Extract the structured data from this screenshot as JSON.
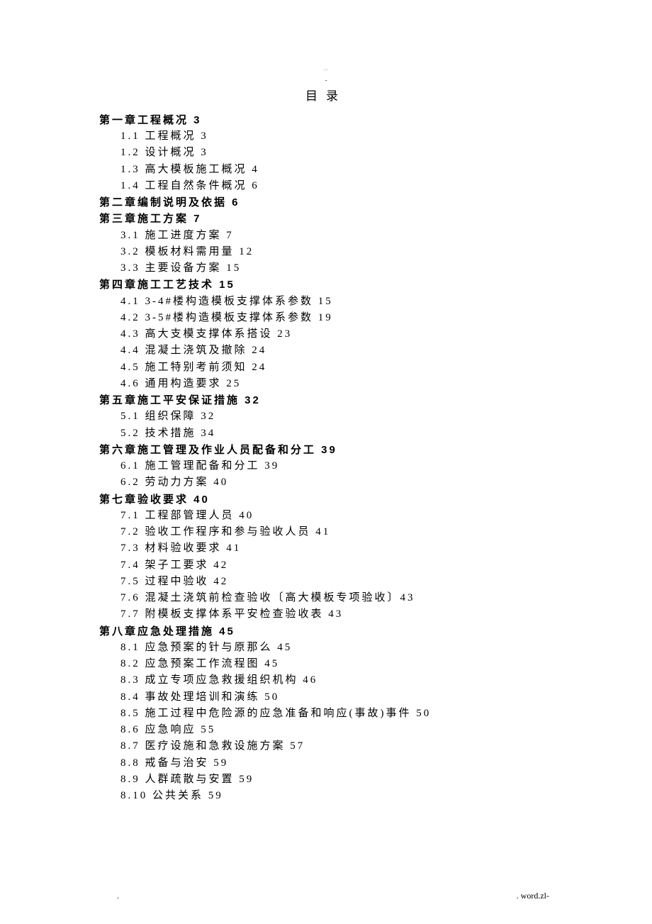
{
  "header_dots": "..",
  "header_dash": "-",
  "title": "目录",
  "footer_left": ".",
  "footer_right": ". word.zl-",
  "toc": [
    {
      "type": "chapter",
      "text": "第一章工程概况 3"
    },
    {
      "type": "section",
      "text": "1.1 工程概况 3"
    },
    {
      "type": "section",
      "text": "1.2 设计概况 3"
    },
    {
      "type": "section",
      "text": "1.3 高大模板施工概况 4"
    },
    {
      "type": "section",
      "text": "1.4 工程自然条件概况 6"
    },
    {
      "type": "chapter",
      "text": "第二章编制说明及依据 6"
    },
    {
      "type": "chapter",
      "text": "第三章施工方案 7"
    },
    {
      "type": "section",
      "text": "3.1 施工进度方案 7"
    },
    {
      "type": "section",
      "text": "3.2 模板材料需用量 12"
    },
    {
      "type": "section",
      "text": "3.3 主要设备方案 15"
    },
    {
      "type": "chapter",
      "text": "第四章施工工艺技术 15"
    },
    {
      "type": "section",
      "text": "4.1 3-4#楼构造模板支撑体系参数 15"
    },
    {
      "type": "section",
      "text": "4.2 3-5#楼构造模板支撑体系参数 19"
    },
    {
      "type": "section",
      "text": "4.3 高大支模支撑体系搭设 23"
    },
    {
      "type": "section",
      "text": "4.4 混凝土浇筑及撤除 24"
    },
    {
      "type": "section",
      "text": "4.5 施工特别考前须知 24"
    },
    {
      "type": "section",
      "text": "4.6 通用构造要求 25"
    },
    {
      "type": "chapter",
      "text": "第五章施工平安保证措施 32"
    },
    {
      "type": "section",
      "text": "5.1 组织保障 32"
    },
    {
      "type": "section",
      "text": "5.2 技术措施 34"
    },
    {
      "type": "chapter",
      "text": "第六章施工管理及作业人员配备和分工 39"
    },
    {
      "type": "section",
      "text": "6.1 施工管理配备和分工 39"
    },
    {
      "type": "section",
      "text": "6.2 劳动力方案 40"
    },
    {
      "type": "chapter",
      "text": "第七章验收要求 40"
    },
    {
      "type": "section",
      "text": "7.1 工程部管理人员 40"
    },
    {
      "type": "section",
      "text": "7.2 验收工作程序和参与验收人员 41"
    },
    {
      "type": "section",
      "text": "7.3 材料验收要求 41"
    },
    {
      "type": "section",
      "text": "7.4 架子工要求 42"
    },
    {
      "type": "section",
      "text": "7.5 过程中验收 42"
    },
    {
      "type": "section",
      "text": "7.6 混凝土浇筑前检查验收〔高大模板专项验收〕43"
    },
    {
      "type": "section",
      "text": "7.7 附模板支撑体系平安检查验收表 43"
    },
    {
      "type": "chapter",
      "text": "第八章应急处理措施 45"
    },
    {
      "type": "section",
      "text": "8.1 应急预案的针与原那么 45"
    },
    {
      "type": "section",
      "text": "8.2 应急预案工作流程图 45"
    },
    {
      "type": "section",
      "text": "8.3 成立专项应急救援组织机构 46"
    },
    {
      "type": "section",
      "text": "8.4 事故处理培训和演练 50"
    },
    {
      "type": "section",
      "text": "8.5 施工过程中危险源的应急准备和响应(事故)事件 50"
    },
    {
      "type": "section",
      "text": "8.6 应急响应 55"
    },
    {
      "type": "section",
      "text": "8.7 医疗设施和急救设施方案 57"
    },
    {
      "type": "section",
      "text": "8.8 戒备与治安 59"
    },
    {
      "type": "section",
      "text": "8.9 人群疏散与安置 59"
    },
    {
      "type": "section",
      "text": "8.10 公共关系 59"
    }
  ]
}
